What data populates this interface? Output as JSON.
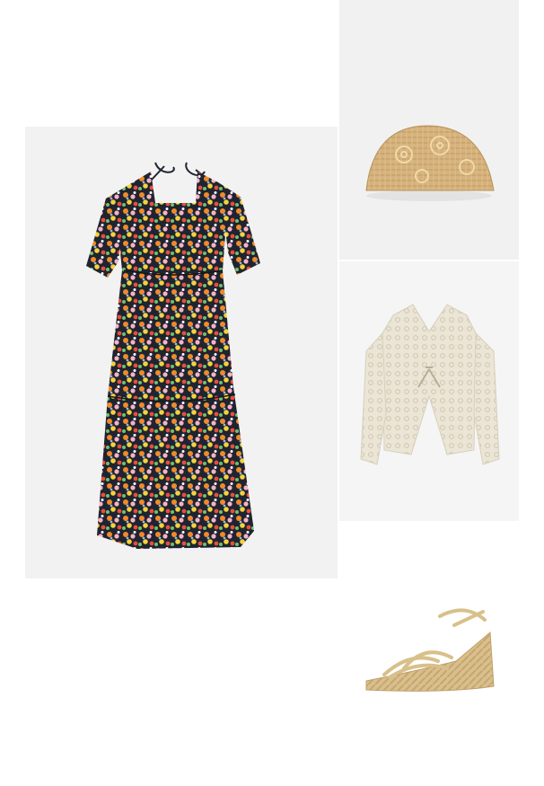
{
  "outfit": {
    "items": [
      {
        "name": "dress",
        "icon": "floral-midi-dress-image"
      },
      {
        "name": "clutch",
        "icon": "straw-clutch-bag-image"
      },
      {
        "name": "cardigan",
        "icon": "crochet-cardigan-image"
      },
      {
        "name": "sandal",
        "icon": "espadrille-wedge-sandal-image"
      }
    ]
  },
  "colors": {
    "dress_base": "#1f2430",
    "dress_flowers": [
      "#f08a2a",
      "#f6b2c8",
      "#f4d23c",
      "#e94e3c",
      "#6fc16f",
      "#ffffff",
      "#8fb7e6"
    ],
    "straw": "#d6b27c",
    "cream": "#ebe5d6",
    "gold": "#d8c08a"
  }
}
